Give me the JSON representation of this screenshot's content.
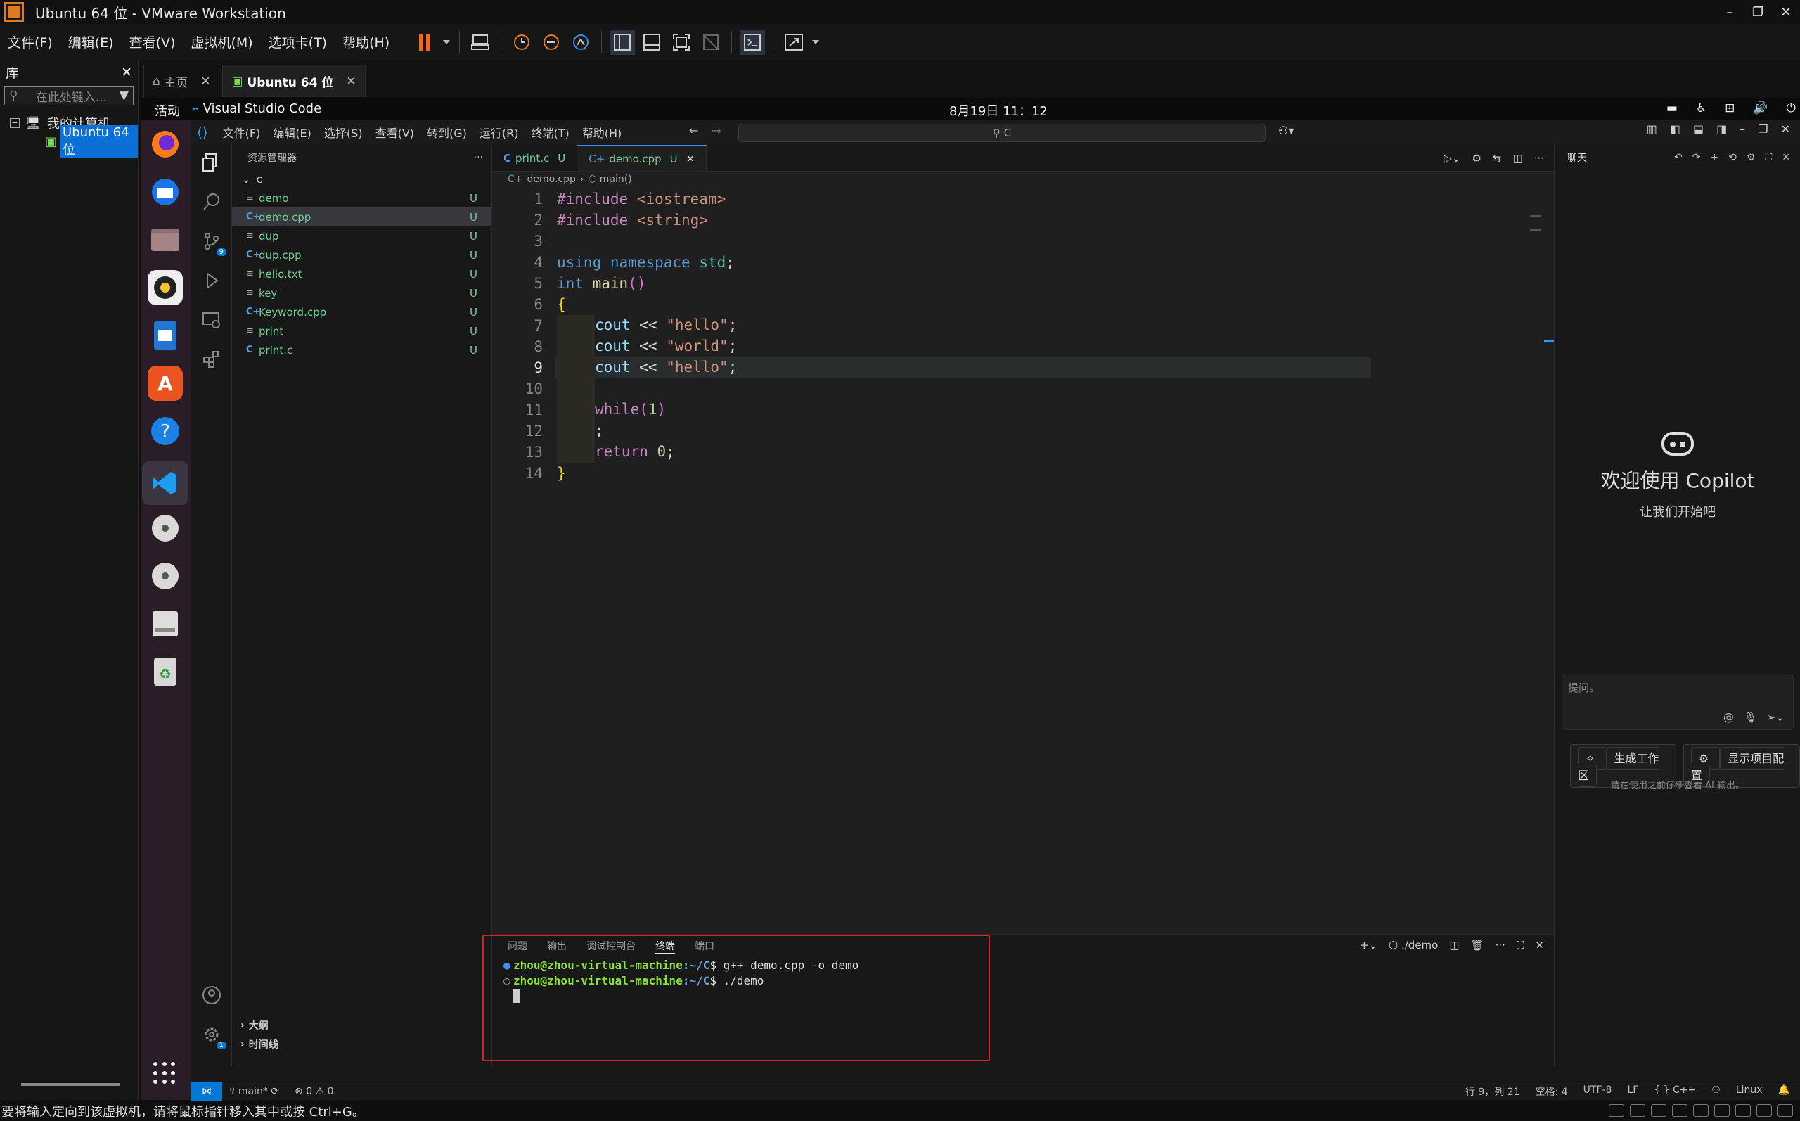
{
  "vmware": {
    "title": "Ubuntu 64 位 - VMware Workstation",
    "menus": [
      "文件(F)",
      "编辑(E)",
      "查看(V)",
      "虚拟机(M)",
      "选项卡(T)",
      "帮助(H)"
    ],
    "library": {
      "title": "库",
      "search_placeholder": "在此处键入...",
      "root": "我的计算机",
      "vm": "Ubuntu 64 位"
    },
    "tabs": {
      "home": "主页",
      "vm": "Ubuntu 64 位"
    },
    "status": "要将输入定向到该虚拟机，请将鼠标指针移入其中或按 Ctrl+G。"
  },
  "ubuntu": {
    "activities": "活动",
    "app_name": "Visual Studio Code",
    "clock": "8月19日  11：12"
  },
  "vscode": {
    "menus": [
      "文件(F)",
      "编辑(E)",
      "选择(S)",
      "查看(V)",
      "转到(G)",
      "运行(R)",
      "终端(T)",
      "帮助(H)"
    ],
    "command_center": "C",
    "scm_badge": "9",
    "settings_badge": "1",
    "explorer": {
      "title": "资源管理器",
      "folder": "c",
      "files": [
        {
          "name": "demo",
          "icon": "≡",
          "status": "U"
        },
        {
          "name": "demo.cpp",
          "icon": "C+",
          "status": "U"
        },
        {
          "name": "dup",
          "icon": "≡",
          "status": "U"
        },
        {
          "name": "dup.cpp",
          "icon": "C+",
          "status": "U"
        },
        {
          "name": "hello.txt",
          "icon": "≡",
          "status": "U"
        },
        {
          "name": "key",
          "icon": "≡",
          "status": "U"
        },
        {
          "name": "Keyword.cpp",
          "icon": "C+",
          "status": "U"
        },
        {
          "name": "print",
          "icon": "≡",
          "status": "U"
        },
        {
          "name": "print.c",
          "icon": "C",
          "status": "U"
        }
      ],
      "outline": "大纲",
      "timeline": "时间线"
    },
    "tabs": [
      {
        "label": "print.c",
        "status": "U"
      },
      {
        "label": "demo.cpp",
        "status": "U"
      }
    ],
    "breadcrumb": {
      "file": "demo.cpp",
      "symbol": "main()"
    },
    "line_numbers": [
      "1",
      "2",
      "3",
      "4",
      "5",
      "6",
      "7",
      "8",
      "9",
      "10",
      "11",
      "12",
      "13",
      "14"
    ],
    "panel": {
      "tabs": [
        "问题",
        "输出",
        "调试控制台",
        "终端",
        "端口"
      ],
      "terminal_name": "./demo",
      "lines": [
        {
          "user": "zhou@zhou-virtual-machine",
          "path": ":~/C",
          "cmd": "$ g++ demo.cpp -o demo"
        },
        {
          "user": "zhou@zhou-virtual-machine",
          "path": ":~/C",
          "cmd": "$ ./demo"
        }
      ]
    },
    "chat": {
      "title": "聊天",
      "welcome": "欢迎使用 Copilot",
      "subtitle": "让我们开始吧",
      "input_placeholder": "提问。",
      "btn_workspace": "生成工作区",
      "btn_config": "显示项目配置",
      "note": "请在使用之前仔细查看 AI 输出。"
    },
    "statusbar": {
      "branch": "main*",
      "problems": "⊗ 0 ⚠ 0",
      "position": "行 9，列 21",
      "spaces": "空格: 4",
      "encoding": "UTF-8",
      "eol": "LF",
      "language": "{ } C++",
      "os": "Linux"
    }
  }
}
